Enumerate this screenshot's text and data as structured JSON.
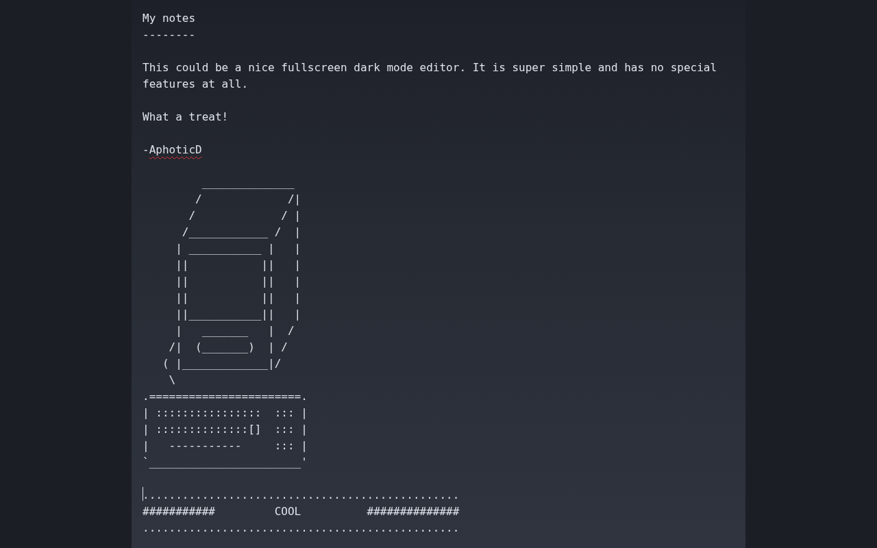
{
  "editor": {
    "blocks": [
      {
        "kind": "heading",
        "text": "My notes"
      },
      {
        "kind": "rule",
        "text": "--------"
      },
      {
        "kind": "paragraph",
        "text": "This could be a nice fullscreen dark mode editor. It is super simple and has no special features at all."
      },
      {
        "kind": "paragraph",
        "text": "What a treat!"
      },
      {
        "kind": "signature",
        "dash": "-",
        "name": "AphoticD",
        "misspelled": true
      },
      {
        "kind": "art",
        "lines": [
          "         ______________",
          "        /             /|",
          "       /             / |",
          "      /____________ /  |",
          "     | ___________ |   |",
          "     ||           ||   |",
          "     ||           ||   |",
          "     ||           ||   |",
          "     ||___________||   |",
          "     |   _______   |  /",
          "    /|  (_______)  | /",
          "   ( |_____________|/",
          "    \\",
          ".=======================.",
          "| ::::::::::::::::  ::: |",
          "| ::::::::::::::[]  ::: |",
          "|   -----------     ::: |",
          "`_______________________'"
        ]
      },
      {
        "kind": "banner",
        "caret": true,
        "lines": [
          "................................................",
          "###########         COOL          ##############",
          "................................................"
        ]
      }
    ]
  }
}
